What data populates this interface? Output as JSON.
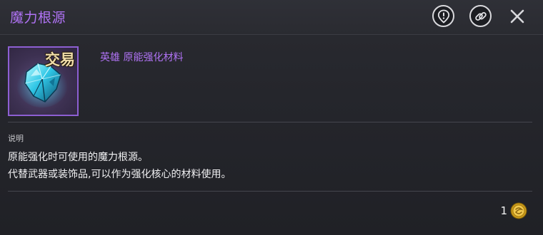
{
  "window": {
    "title": "魔力根源"
  },
  "header": {
    "icons": [
      "alert-pin-icon",
      "chain-link-icon",
      "close-icon"
    ]
  },
  "item": {
    "trade_tag": "交易",
    "grade_line": "英雄 原能强化材料",
    "icon_name": "crystal-shard-icon"
  },
  "description": {
    "label": "说明",
    "line1": "原能强化时可使用的魔力根源。",
    "line2": "代替武器或装饰品,可以作为强化核心的材料使用。"
  },
  "price": {
    "value": "1",
    "currency_icon": "gold-coin-icon"
  },
  "colors": {
    "title": "#b073f5",
    "grade": "#b073f5",
    "frame_border": "#8d5fd3",
    "background": "#25262c"
  }
}
